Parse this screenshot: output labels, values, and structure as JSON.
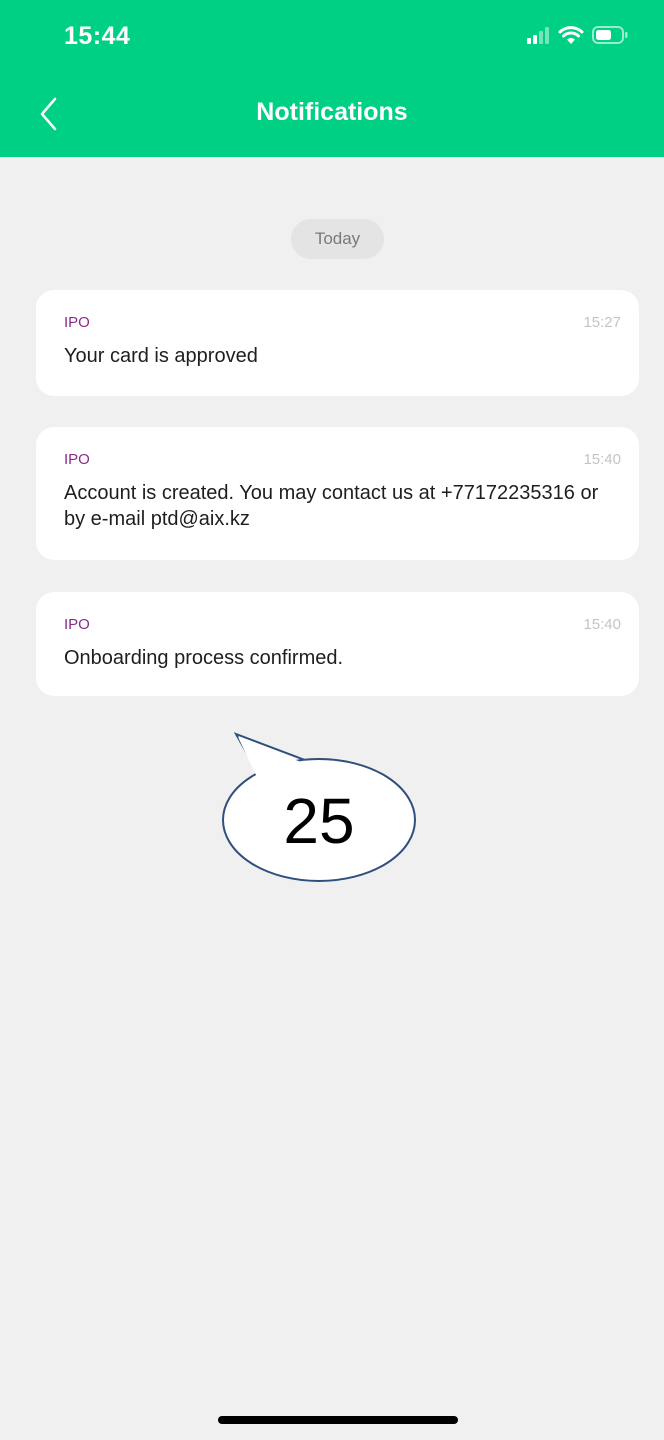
{
  "status_bar": {
    "time": "15:44",
    "signal_icon": "signal-icon",
    "wifi_icon": "wifi-icon",
    "battery_icon": "battery-icon"
  },
  "header": {
    "back_icon": "chevron-left-icon",
    "title": "Notifications"
  },
  "date_group": {
    "label": "Today"
  },
  "notifications": [
    {
      "sender": "IPO",
      "time": "15:27",
      "message": "Your card is approved"
    },
    {
      "sender": "IPO",
      "time": "15:40",
      "message": "Account is created. You may contact us at +77172235316 or by e-mail ptd@aix.kz"
    },
    {
      "sender": "IPO",
      "time": "15:40",
      "message": "Onboarding process confirmed."
    }
  ],
  "callout": {
    "number": "25"
  },
  "colors": {
    "header_bg": "#00d084",
    "page_bg": "#f0f0f0",
    "sender": "#8a2b8c",
    "callout_border": "#2f4f7f"
  }
}
